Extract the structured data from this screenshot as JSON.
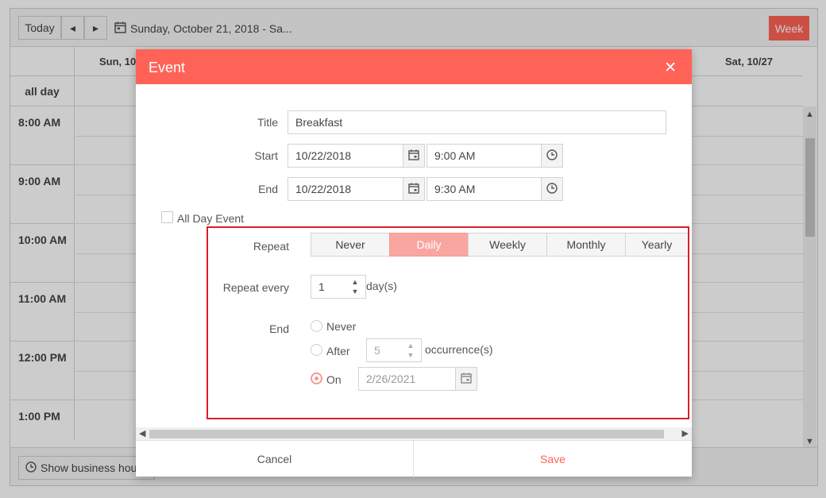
{
  "toolbar": {
    "today": "Today",
    "prev": "◂",
    "next": "▸",
    "date_range": "Sunday, October 21, 2018 - Sa...",
    "week": "Week"
  },
  "header": {
    "first_day": "Sun, 10",
    "last_day": "Sat, 10/27",
    "all_day": "all day"
  },
  "times": [
    "8:00 AM",
    "9:00 AM",
    "10:00 AM",
    "11:00 AM",
    "12:00 PM",
    "1:00 PM"
  ],
  "footer": {
    "business_hours": "Show business hours"
  },
  "dialog": {
    "title": "Event",
    "close": "✕",
    "title_label": "Title",
    "title_value": "Breakfast",
    "start_label": "Start",
    "start_date": "10/22/2018",
    "start_time": "9:00 AM",
    "end_label": "End",
    "end_date": "10/22/2018",
    "end_time": "9:30 AM",
    "all_day_label": "All Day Event",
    "repeat_label": "Repeat",
    "repeat_options": [
      "Never",
      "Daily",
      "Weekly",
      "Monthly",
      "Yearly"
    ],
    "repeat_selected": "Daily",
    "repeat_every_label": "Repeat every",
    "repeat_every_value": "1",
    "repeat_every_unit": "day(s)",
    "end_rule_label": "End",
    "end_never": "Never",
    "end_after": "After",
    "end_after_value": "5",
    "end_after_unit": "occurrence(s)",
    "end_on": "On",
    "end_on_date": "2/26/2021",
    "cancel": "Cancel",
    "save": "Save"
  },
  "colors": {
    "accent": "#ff6358",
    "highlight_border": "#d81f26",
    "active_segment": "#f9a6a1"
  }
}
